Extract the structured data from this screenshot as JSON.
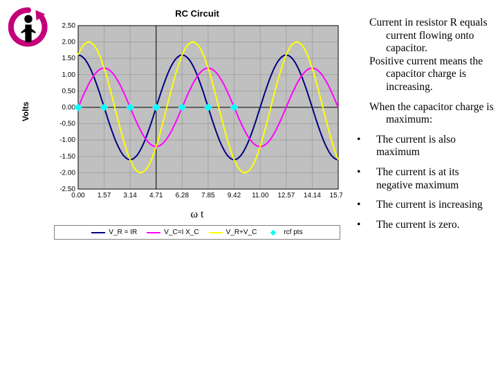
{
  "chart_data": {
    "type": "line",
    "title": "RC Circuit",
    "xlabel": "ω t",
    "ylabel": "Volts",
    "xlim": [
      0,
      15.71
    ],
    "ylim": [
      -2.5,
      2.5
    ],
    "xticks": [
      0.0,
      1.57,
      3.14,
      4.71,
      6.28,
      7.85,
      9.42,
      11.0,
      12.57,
      14.14,
      15.71
    ],
    "xtick_labels": [
      "0.00",
      "1.57",
      "3.14",
      "4.71",
      "6.28",
      "7.85",
      "9.42",
      "11.00",
      "12.57",
      "14.14",
      "15.71"
    ],
    "yticks": [
      -2.5,
      -2.0,
      -1.5,
      -1.0,
      -0.5,
      0.0,
      0.5,
      1.0,
      1.5,
      2.0,
      2.5
    ],
    "ytick_labels": [
      "-2.50",
      "-2.00",
      "-1.50",
      "-1.00",
      "-0.50",
      "0.00",
      "0.50",
      "1.00",
      "1.50",
      "2.00",
      "2.50"
    ],
    "legend": [
      "V_R = IR",
      "V_C=I X_C",
      "V_R+V_C",
      "rcf pts"
    ],
    "colors": {
      "V_R": "#000080",
      "V_C": "#ff00ff",
      "V_R+V_C": "#ffff00",
      "rcf_pts": "#00ffff"
    },
    "series": [
      {
        "name": "V_R",
        "amplitude": 1.6,
        "phase": 1.5708,
        "color": "#000080"
      },
      {
        "name": "V_C",
        "amplitude": 1.2,
        "phase": 0.0,
        "color": "#ff00ff"
      },
      {
        "name": "V_R+V_C",
        "amplitude": 2.0,
        "phase": 0.93,
        "color": "#ffff00"
      }
    ],
    "points": {
      "name": "rcf pts",
      "color": "#00ffff",
      "x": [
        0.0,
        1.57,
        3.14,
        4.71,
        6.28,
        7.85,
        9.42
      ],
      "y": [
        0,
        0,
        0,
        0,
        0,
        0,
        0
      ]
    }
  },
  "text": {
    "intro1": "Current in resistor R equals current flowing onto capacitor.",
    "intro2": "Positive current means the capacitor charge is increasing.",
    "question": "When the capacitor charge is maximum:",
    "options": [
      "The current is also maximum",
      "The current is at its negative maximum",
      "The current is increasing",
      "The current is zero."
    ],
    "bullet": "•"
  },
  "omega_t": {
    "omega": "ω",
    "t": "t"
  }
}
